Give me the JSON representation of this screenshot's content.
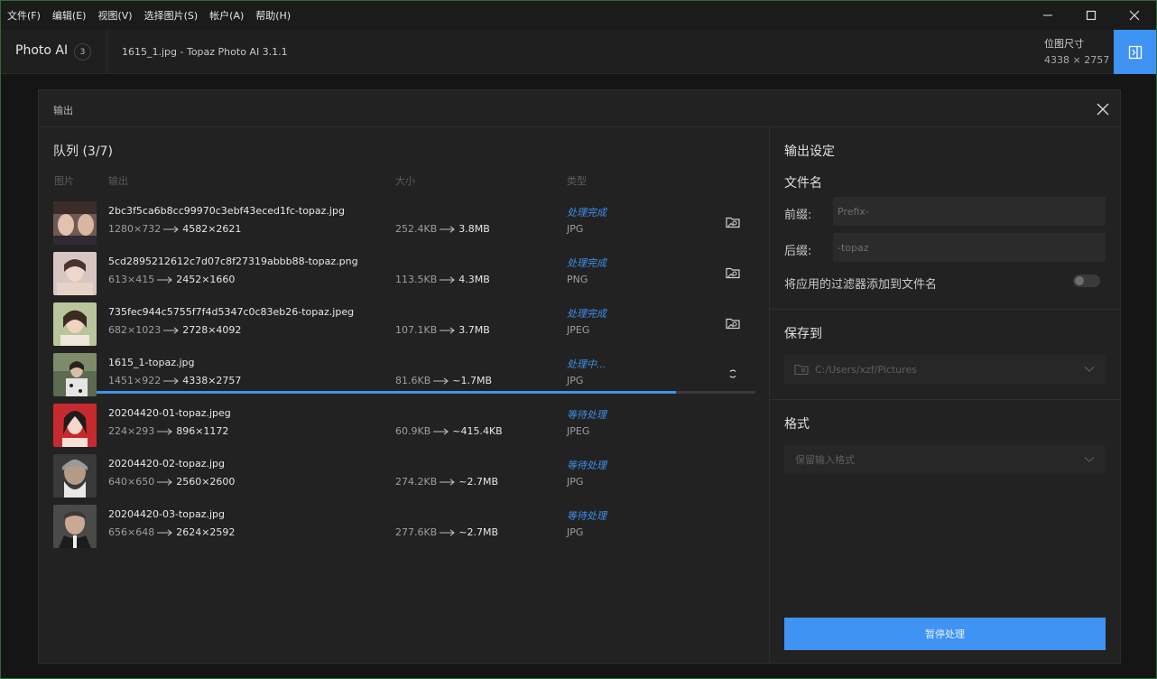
{
  "menu": [
    "文件(F)",
    "编辑(E)",
    "视图(V)",
    "选择图片(S)",
    "帐户(A)",
    "帮助(H)"
  ],
  "header": {
    "app_name": "Photo AI",
    "badge": "3",
    "file_title": "1615_1.jpg - Topaz Photo AI 3.1.1",
    "image_size_label": "位图尺寸",
    "image_size_value": "4338 × 2757"
  },
  "dialog": {
    "title": "输出",
    "queue_title": "队列 (3/7)",
    "columns": {
      "image": "图片",
      "output": "输出",
      "size": "大小",
      "type": "类型"
    },
    "rows": [
      {
        "filename": "2bc3f5ca6b8cc99970c3ebf43eced1fc-topaz.jpg",
        "dim_from": "1280×732",
        "dim_to": "4582×2621",
        "size_from": "252.4KB",
        "size_to": "3.8MB",
        "status": "处理完成",
        "type": "JPG",
        "icon": "open-folder-image-icon"
      },
      {
        "filename": "5cd2895212612c7d07c8f27319abbb88-topaz.png",
        "dim_from": "613×415",
        "dim_to": "2452×1660",
        "size_from": "113.5KB",
        "size_to": "4.3MB",
        "status": "处理完成",
        "type": "PNG",
        "icon": "open-folder-image-icon"
      },
      {
        "filename": "735fec944c5755f7f4d5347c0c83eb26-topaz.jpeg",
        "dim_from": "682×1023",
        "dim_to": "2728×4092",
        "size_from": "107.1KB",
        "size_to": "3.7MB",
        "status": "处理完成",
        "type": "JPEG",
        "icon": "open-folder-image-icon"
      },
      {
        "filename": "1615_1-topaz.jpg",
        "dim_from": "1451×922",
        "dim_to": "4338×2757",
        "size_from": "81.6KB",
        "size_to": "~1.7MB",
        "status": "处理中...",
        "type": "JPG",
        "icon": "spinner-icon",
        "progress": 0.88
      },
      {
        "filename": "20204420-01-topaz.jpeg",
        "dim_from": "224×293",
        "dim_to": "896×1172",
        "size_from": "60.9KB",
        "size_to": "~415.4KB",
        "status": "等待处理",
        "type": "JPEG"
      },
      {
        "filename": "20204420-02-topaz.jpg",
        "dim_from": "640×650",
        "dim_to": "2560×2600",
        "size_from": "274.2KB",
        "size_to": "~2.7MB",
        "status": "等待处理",
        "type": "JPG"
      },
      {
        "filename": "20204420-03-topaz.jpg",
        "dim_from": "656×648",
        "dim_to": "2624×2592",
        "size_from": "277.6KB",
        "size_to": "~2.7MB",
        "status": "等待处理",
        "type": "JPG"
      }
    ]
  },
  "settings": {
    "title": "输出设定",
    "filename_heading": "文件名",
    "prefix_label": "前缀:",
    "prefix_placeholder": "Prefix-",
    "suffix_label": "后缀:",
    "suffix_value": "-topaz",
    "append_filters_label": "将应用的过滤器添加到文件名",
    "append_filters_on": false,
    "save_to_heading": "保存到",
    "save_path": "C:/Users/xzf/Pictures",
    "format_heading": "格式",
    "format_value": "保留输入格式",
    "pause_button": "暂停处理"
  },
  "colors": {
    "accent": "#3f93f3",
    "status": "#3f8fe8"
  }
}
